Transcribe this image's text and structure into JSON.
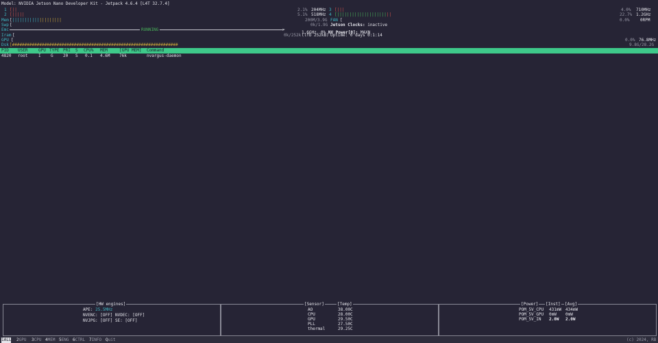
{
  "header": {
    "model": "Model: NVIDIA Jetson Nano Developer Kit - Jetpack 4.6.4 [L4T 32.7.4]"
  },
  "cpu": [
    {
      "id": "1",
      "bar": "[||",
      "pct": "2.1%",
      "freq": "204MHz"
    },
    {
      "id": "2",
      "bar": "[|||||",
      "pct": "5.1%",
      "freq": "518MHz"
    },
    {
      "id": "3",
      "bar": "[|||",
      "pct": "4.0%",
      "freq": "710MHz"
    },
    {
      "id": "4",
      "bar": "[||||||||||||||||||||||",
      "pct": "22.7%",
      "freq": "1.2GHz"
    }
  ],
  "mem": {
    "label": "Mem",
    "bar": "[||||||||||||||||||||",
    "value": "200M/3.9G"
  },
  "swp": {
    "label": "Swp",
    "bar": "[",
    "value": "0k/1.9G"
  },
  "emc": {
    "label": "Emc",
    "status": "RUNNING",
    "freq": "1.6GHz"
  },
  "iram": {
    "label": "Iram",
    "bar": "[",
    "value": "0k/252k",
    "lfb": "(lfb 252kB)"
  },
  "gpu": {
    "label": "GPU",
    "bar": "[",
    "value": "0.0%",
    "freq": "76.8MHz"
  },
  "dsk": {
    "label": "Dsk",
    "bar": "[###################################################################",
    "value": "9.8G/28.2G"
  },
  "fan": {
    "label": "FAN",
    "bar": "[",
    "pct": "0.0%",
    "rpm": "0RPM"
  },
  "info": {
    "clocks_label": "Jetson Clocks:",
    "clocks_value": "inactive",
    "nvp_label": "NV Power[0]:",
    "nvp_value": "MAXN",
    "uptime": "Uptime: 0 days 0:1:14",
    "emc_pct": "0%"
  },
  "process_table": {
    "columns": [
      "PID",
      "USER",
      "GPU",
      "TYPE",
      "PRI",
      "S",
      "CPU%",
      "MEM",
      "[GPU MEM]",
      "Command"
    ],
    "rows": [
      [
        "4820",
        "root",
        "I",
        "G",
        "20",
        "S",
        "0.1",
        "4.6M",
        "76k",
        "nvargus-daemon"
      ]
    ]
  },
  "hw_engines": {
    "title": "[HW engines]",
    "ape_label": "APE:",
    "ape_value": "25.5MHz",
    "nvenc": "NVENC: [OFF]",
    "nvdec": "NVDEC: [OFF]",
    "nvjpg": "NVJPG: [OFF]",
    "se": "SE: [OFF]"
  },
  "sensors": {
    "title_sensor": "[Sensor]",
    "title_temp": "[Temp]",
    "rows": [
      {
        "name": "AO",
        "temp": "38.00C"
      },
      {
        "name": "CPU",
        "temp": "28.00C"
      },
      {
        "name": "GPU",
        "temp": "29.50C"
      },
      {
        "name": "PLL",
        "temp": "27.50C"
      },
      {
        "name": "thermal",
        "temp": "29.25C"
      }
    ]
  },
  "power": {
    "title_power": "[Power]",
    "title_inst": "[Inst]",
    "title_avg": "[Avg]",
    "rows": [
      {
        "name": "POM_5V_CPU",
        "inst": "431mW",
        "avg": "434mW"
      },
      {
        "name": "POM_5V_GPU",
        "inst": "0mW",
        "avg": "0mW"
      },
      {
        "name": "POM_5V_IN",
        "inst": "2.0W",
        "avg": "2.0W"
      }
    ]
  },
  "footer": {
    "tabs": [
      {
        "key": "1",
        "label": "ALL"
      },
      {
        "key": "2",
        "label": "GPU"
      },
      {
        "key": "3",
        "label": "CPU"
      },
      {
        "key": "4",
        "label": "MEM"
      },
      {
        "key": "5",
        "label": "ENG"
      },
      {
        "key": "6",
        "label": "CTRL"
      },
      {
        "key": "7",
        "label": "INFO"
      },
      {
        "key": "Q",
        "label": "uit"
      }
    ],
    "copyright": "(c) 2024, RB"
  }
}
